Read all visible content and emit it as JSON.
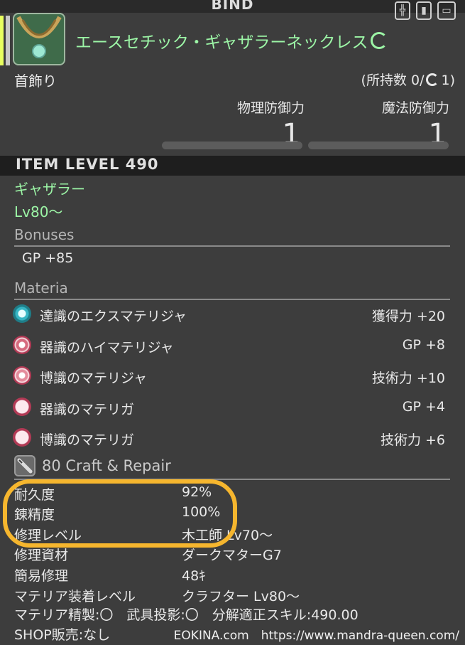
{
  "header": {
    "title": "BIND"
  },
  "item": {
    "name": "エースセチック・ギャザラーネックレス",
    "slot": "首飾り",
    "owned_prefix": "(所持数 0/",
    "owned_suffix": "1)"
  },
  "stats": [
    {
      "label": "物理防御力",
      "value": "1"
    },
    {
      "label": "魔法防御力",
      "value": "1"
    }
  ],
  "item_level": "ITEM LEVEL 490",
  "class_name": "ギャザラー",
  "level_req": "Lv80～",
  "bonuses": {
    "heading": "Bonuses",
    "items": [
      "GP +85"
    ]
  },
  "materia": {
    "heading": "Materia",
    "items": [
      {
        "name": "達識のエクスマテリジャ",
        "value": "獲得力 +20"
      },
      {
        "name": "器識のハイマテリジャ",
        "value": "GP +8"
      },
      {
        "name": "博識のマテリジャ",
        "value": "技術力 +10"
      },
      {
        "name": "器識のマテリガ",
        "value": "GP +4"
      },
      {
        "name": "博識のマテリガ",
        "value": "技術力 +6"
      }
    ]
  },
  "craft": {
    "heading": "80 Craft & Repair",
    "rows": [
      {
        "key": "耐久度",
        "value": "92%"
      },
      {
        "key": "錬精度",
        "value": "100%"
      },
      {
        "key": "修理レベル",
        "value": "木工師 Lv70～"
      },
      {
        "key": "修理資材",
        "value": "ダークマターG7"
      },
      {
        "key": "簡易修理",
        "value": "48ｷ"
      },
      {
        "key": "マテリア装着レベル",
        "value": "クラフター Lv80～"
      }
    ]
  },
  "footer": {
    "line1": "マテリア精製:〇　武具投影:〇　分解適正スキル:490.00",
    "line2": "SHOP販売:なし"
  },
  "watermark": "EOKINA.com　https://www.mandra-queen.com/",
  "colors": {
    "accent_green": "#9cf5a6",
    "highlight": "#f6b62e",
    "background": "#3d3d3d"
  }
}
